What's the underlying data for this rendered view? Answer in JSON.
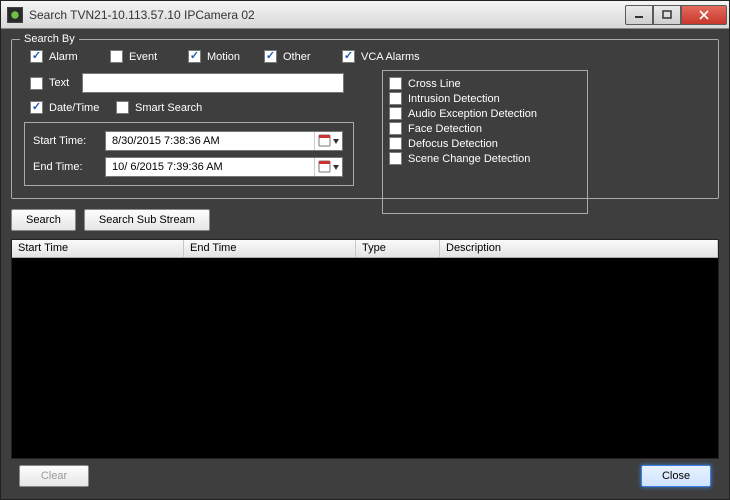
{
  "window": {
    "title": "Search  TVN21-10.113.57.10  IPCamera 02"
  },
  "groupbox": {
    "title": "Search By"
  },
  "checks": {
    "alarm": {
      "label": "Alarm",
      "checked": true
    },
    "event": {
      "label": "Event",
      "checked": false
    },
    "motion": {
      "label": "Motion",
      "checked": true
    },
    "other": {
      "label": "Other",
      "checked": true
    },
    "vca": {
      "label": "VCA Alarms",
      "checked": true
    },
    "text": {
      "label": "Text",
      "checked": false
    },
    "datetime": {
      "label": "Date/Time",
      "checked": true
    },
    "smart": {
      "label": "Smart Search",
      "checked": false
    }
  },
  "textValue": "",
  "vca_items": [
    {
      "label": "Cross Line",
      "checked": false
    },
    {
      "label": "Intrusion Detection",
      "checked": false
    },
    {
      "label": "Audio Exception Detection",
      "checked": false
    },
    {
      "label": "Face Detection",
      "checked": false
    },
    {
      "label": "Defocus Detection",
      "checked": false
    },
    {
      "label": "Scene Change Detection",
      "checked": false
    }
  ],
  "start": {
    "label": "Start Time:",
    "value": "8/30/2015   7:38:36 AM"
  },
  "end": {
    "label": "End Time:",
    "value": "10/ 6/2015   7:39:36 AM"
  },
  "buttons": {
    "search": "Search",
    "searchSub": "Search Sub Stream",
    "clear": "Clear",
    "close": "Close"
  },
  "columns": {
    "start": "Start Time",
    "end": "End Time",
    "type": "Type",
    "desc": "Description"
  }
}
